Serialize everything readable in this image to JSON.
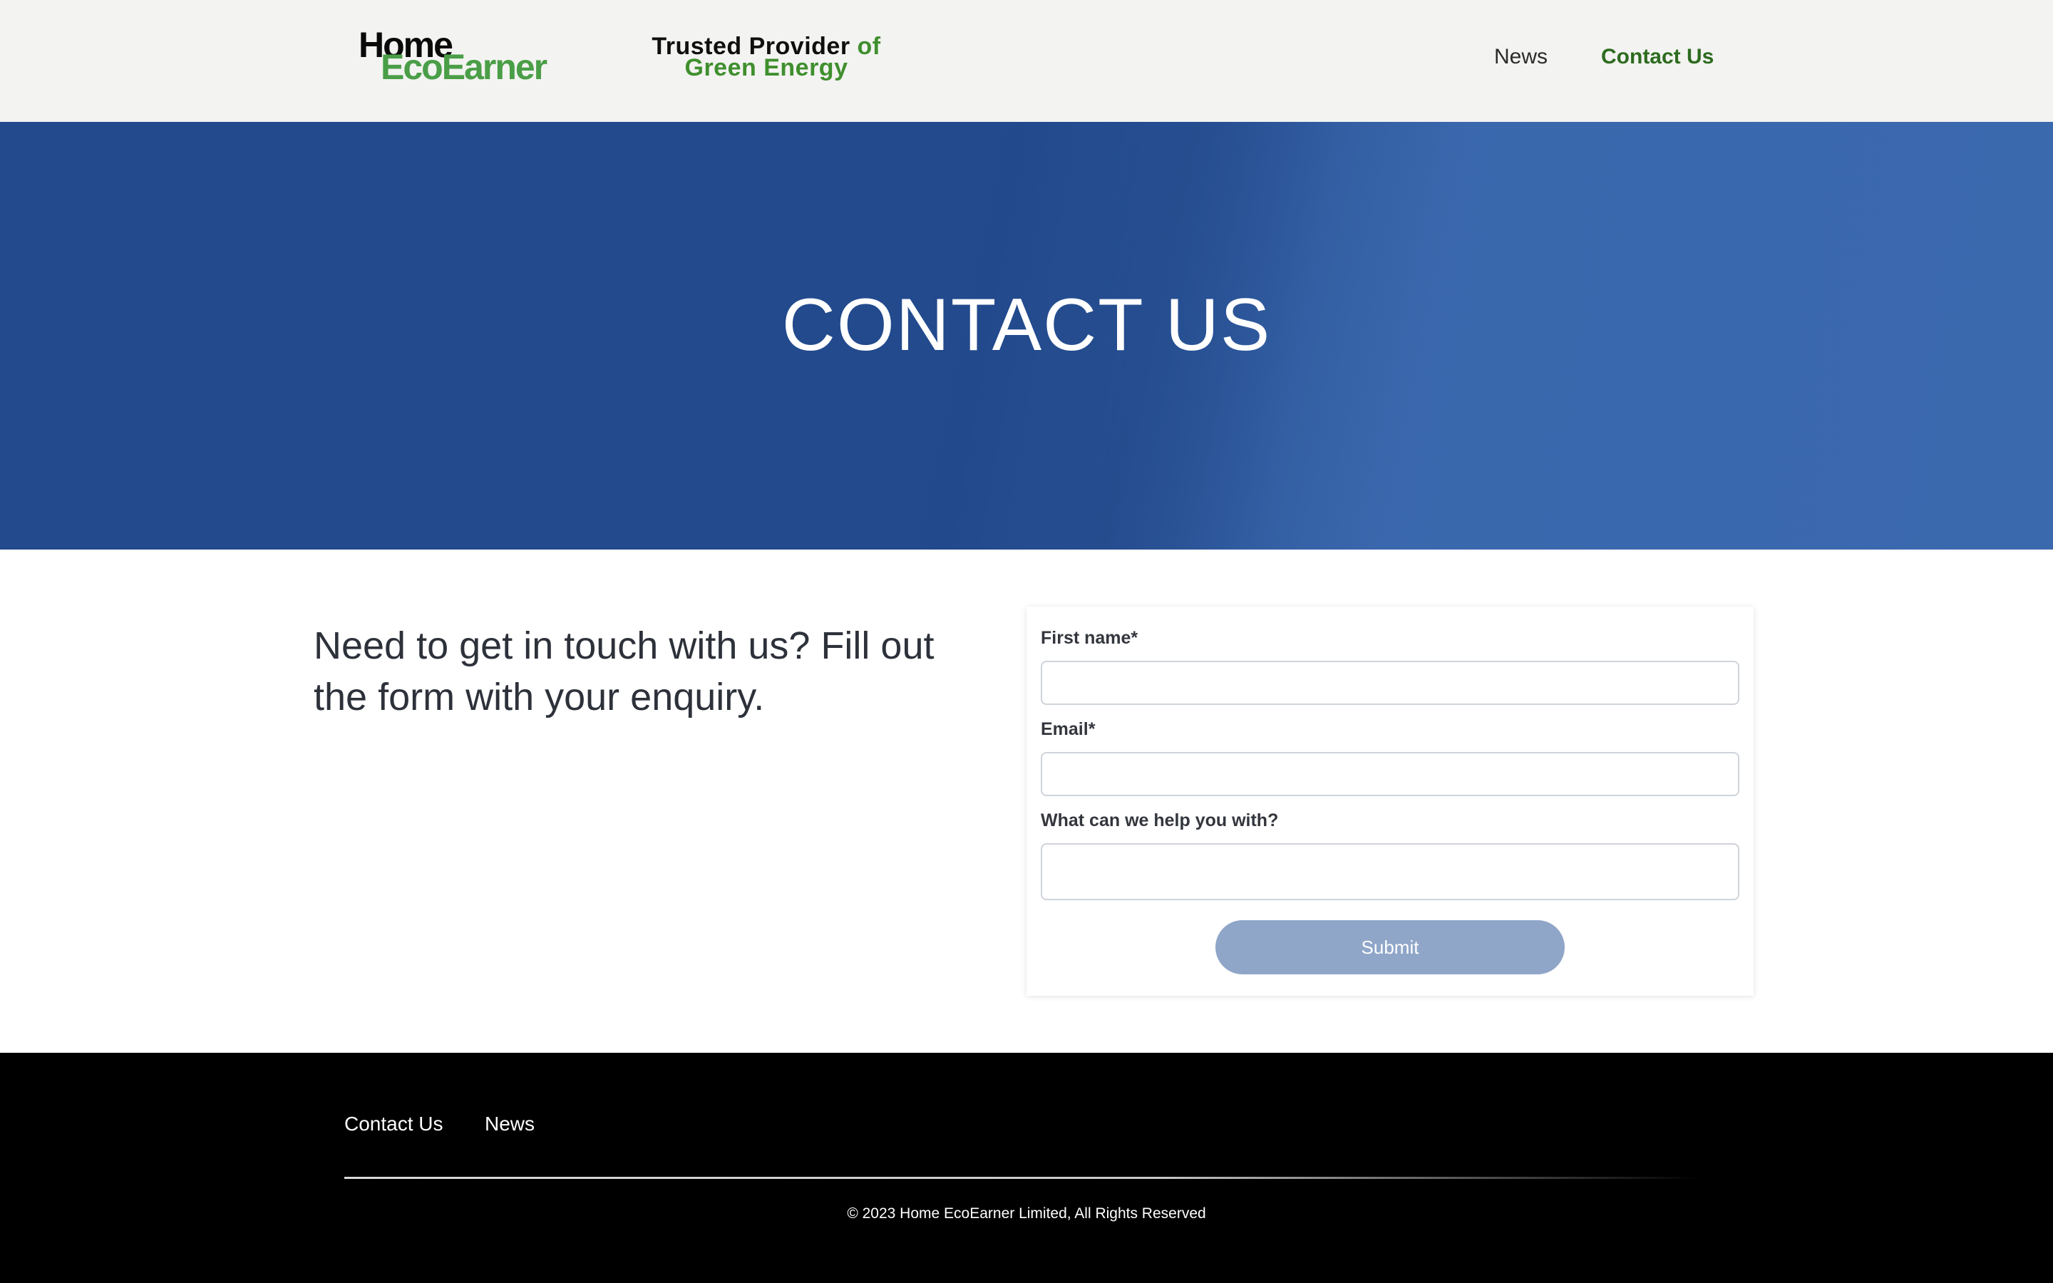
{
  "header": {
    "logo_line1": "Home",
    "logo_line2": "EcoEarner",
    "tagline_part1": "Trusted Provider",
    "tagline_part2": "of",
    "tagline_part3": "Green Energy",
    "nav": [
      {
        "label": "News"
      },
      {
        "label": "Contact Us"
      }
    ]
  },
  "hero": {
    "title": "CONTACT US"
  },
  "content": {
    "intro": "Need to get in touch with us? Fill out the form with your enquiry."
  },
  "form": {
    "first_name_label": "First name*",
    "first_name_value": "",
    "email_label": "Email*",
    "email_value": "",
    "help_label": "What can we help you with?",
    "help_value": "",
    "submit_label": "Submit"
  },
  "footer": {
    "links": [
      {
        "label": "Contact Us"
      },
      {
        "label": "News"
      }
    ],
    "copyright": "© 2023 Home EcoEarner Limited, All Rights Reserved"
  },
  "colors": {
    "brand_green": "#4a9e47",
    "active_nav_green": "#2d6b1f",
    "hero_blue": "#224a8d",
    "hero_blue_light": "#3b69ae",
    "submit_disabled": "#8fa6c8",
    "footer_bg": "#000000"
  }
}
